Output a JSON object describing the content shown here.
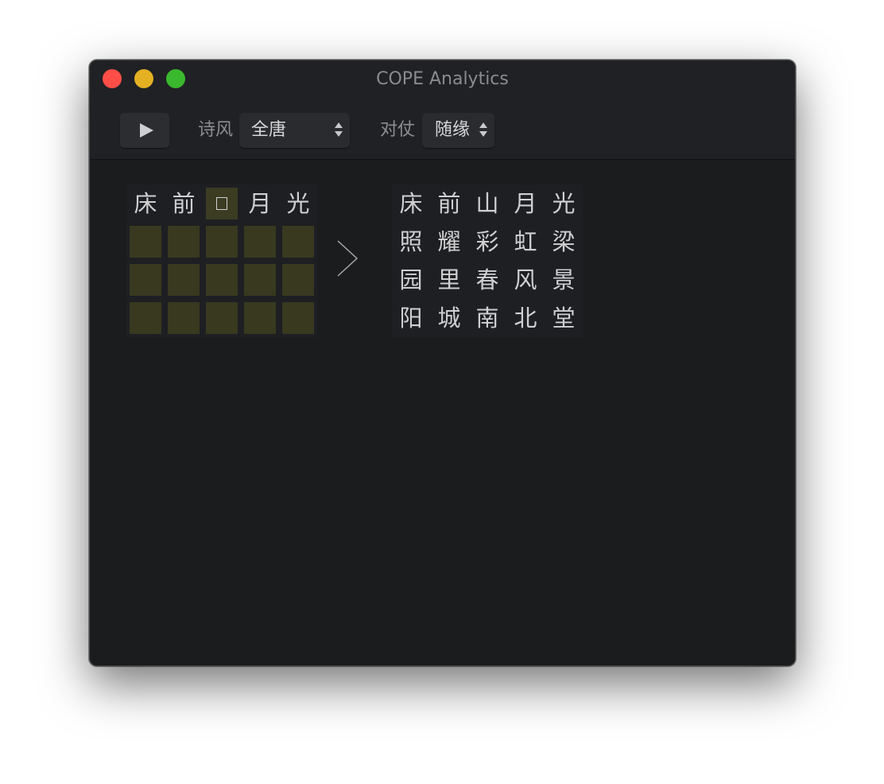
{
  "window": {
    "title": "COPE Analytics"
  },
  "toolbar": {
    "play_icon": "play-icon",
    "style_label": "诗风",
    "style_value": "全唐",
    "pairing_label": "对仗",
    "pairing_value": "随缘"
  },
  "input_grid": {
    "rows": [
      [
        "床",
        "前",
        "",
        "月",
        "光"
      ],
      [
        "",
        "",
        "",
        "",
        ""
      ],
      [
        "",
        "",
        "",
        "",
        ""
      ],
      [
        "",
        "",
        "",
        "",
        ""
      ]
    ],
    "focused_cell": "r0c2"
  },
  "output_grid": {
    "rows": [
      [
        "床",
        "前",
        "山",
        "月",
        "光"
      ],
      [
        "照",
        "耀",
        "彩",
        "虹",
        "梁"
      ],
      [
        "园",
        "里",
        "春",
        "风",
        "景"
      ],
      [
        "阳",
        "城",
        "南",
        "北",
        "堂"
      ]
    ]
  },
  "colors": {
    "window_bg": "#1b1c1e",
    "empty_cell": "#38391f",
    "text": "#cfcfd1",
    "close": "#fe4e47",
    "minimize": "#e3b122",
    "maximize": "#3ab82e"
  }
}
